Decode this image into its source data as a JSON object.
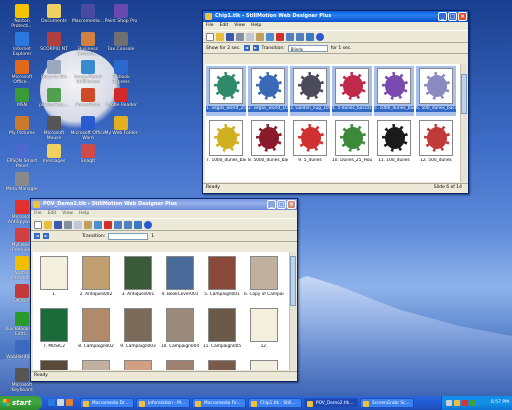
{
  "desktop_icons": [
    {
      "label": "Norton Protecti...",
      "color": "#f5c400"
    },
    {
      "label": "Internet Explorer",
      "color": "#2a79e0"
    },
    {
      "label": "Microsoft Office...",
      "color": "#e06a1a"
    },
    {
      "label": "MSN",
      "color": "#3a9a3a"
    },
    {
      "label": "My Pictures",
      "color": "#c97a2a"
    },
    {
      "label": "EPSON Smart Panel",
      "color": "#4a6ad0"
    },
    {
      "label": "Meta Manager",
      "color": "#8a8a8a"
    },
    {
      "label": "Microsoft AntiSpyware",
      "color": "#e03030"
    },
    {
      "label": "MyLabels Premium",
      "color": "#d04040"
    },
    {
      "label": "Norton Internet...",
      "color": "#f0c000"
    },
    {
      "label": "FAQGen",
      "color": "#c03a3a"
    },
    {
      "label": "QuickBooks Pro Editi...",
      "color": "#2a9a2a"
    },
    {
      "label": "WebPosition 3",
      "color": "#3a6ac0"
    },
    {
      "label": "Microsoft Keyboard",
      "color": "#555555"
    },
    {
      "label": "Documents",
      "color": "#f0d060"
    },
    {
      "label": "SCORPIO NT",
      "color": "#b04040"
    },
    {
      "label": "Recycle Bin",
      "color": "#9aa8c0"
    },
    {
      "label": "pPokerSetu...",
      "color": "#50a050"
    },
    {
      "label": "Microsoft Mouse",
      "color": "#555555"
    },
    {
      "label": "messages",
      "color": "#f0d060"
    },
    {
      "label": "Macromedia...",
      "color": "#4a4aa0"
    },
    {
      "label": "Business Contact...",
      "color": "#d08040"
    },
    {
      "label": "ImageMatch StillMotion",
      "color": "#3a8ad0"
    },
    {
      "label": "PowerPoint",
      "color": "#d04a2a"
    },
    {
      "label": "Microsoft Office Word",
      "color": "#2a5ad0"
    },
    {
      "label": "SnagIt",
      "color": "#d04a4a"
    },
    {
      "label": "Paint Shop Pro",
      "color": "#6a4ab0"
    },
    {
      "label": "Fax Console",
      "color": "#707070"
    },
    {
      "label": "Outlook Express",
      "color": "#2a6ad0"
    },
    {
      "label": "Adobe Reader",
      "color": "#d02a2a"
    },
    {
      "label": "My Web Folder",
      "color": "#e0b020"
    }
  ],
  "window_chips": {
    "title": "Chip1.tlk - StillMotion Web Designer Plus",
    "menu": [
      "File",
      "Edit",
      "View",
      "Help"
    ],
    "show_for_label": "Show for 2 sec.",
    "transition_label": "Transition:",
    "transition_value": "Blinds",
    "for_label": "for 1 sec.",
    "items": [
      {
        "caption": "1. vegas_world_2509",
        "selected": true,
        "color": "#2f8a6a"
      },
      {
        "caption": "2. vegas_world_1000",
        "selected": true,
        "color": "#3a6ab5"
      },
      {
        "caption": "3. Golden_nug_1000",
        "selected": true,
        "color": "#4a4a5a"
      },
      {
        "caption": "4. 5-dunes_baccarat",
        "selected": true,
        "color": "#c02a4a"
      },
      {
        "caption": "5. 1000_dunes_bacca",
        "selected": true,
        "color": "#7a4ab0"
      },
      {
        "caption": "6. 500_dunes_bacca",
        "selected": true,
        "color": "#8a8ac0"
      },
      {
        "caption": "7. 1000_dunes_bacca",
        "selected": false,
        "color": "#d0b020"
      },
      {
        "caption": "8. 5000_dunes_bacca",
        "selected": false,
        "color": "#8a1a2a"
      },
      {
        "caption": "9. 5_dunes",
        "selected": false,
        "color": "#d03030"
      },
      {
        "caption": "10. Dunes_25_House",
        "selected": false,
        "color": "#3a8a3a"
      },
      {
        "caption": "11. 100_dunes",
        "selected": false,
        "color": "#1a1a1a"
      },
      {
        "caption": "12. 500_dunes",
        "selected": false,
        "color": "#c03a3a"
      }
    ],
    "status_left": "Ready",
    "status_right": "Slide 6 of 14"
  },
  "window_pov": {
    "title": "POV_Demo2.tlk - StillMotion Web Designer Plus",
    "menu": [
      "File",
      "Edit",
      "View",
      "Help"
    ],
    "transition_label": "Transition:",
    "transition_value": "",
    "count_value": "1",
    "items": [
      {
        "caption": "1.",
        "color": "#f4f0e0"
      },
      {
        "caption": "2. Antiques002",
        "color": "#c0a070"
      },
      {
        "caption": "3. Antiques001",
        "color": "#3a5a3a"
      },
      {
        "caption": "4. BookCover001",
        "color": "#4a6a9a"
      },
      {
        "caption": "5. Campaign001",
        "color": "#8a4a3a"
      },
      {
        "caption": "6. Copy of Campaign002",
        "color": "#c0b0a0"
      },
      {
        "caption": "7. MUSIC2",
        "color": "#1a6a3a"
      },
      {
        "caption": "8. Campaign002",
        "color": "#b08a6a"
      },
      {
        "caption": "9. Campaign003",
        "color": "#7a6a5a"
      },
      {
        "caption": "10. Campaign004",
        "color": "#9a8a7a"
      },
      {
        "caption": "11. Campaign005",
        "color": "#6a5a4a"
      },
      {
        "caption": "12.",
        "color": "#f4f0e0"
      },
      {
        "caption": "",
        "color": "#5a4a3a"
      },
      {
        "caption": "",
        "color": "#c0b0a0"
      },
      {
        "caption": "",
        "color": "#d0a080"
      },
      {
        "caption": "",
        "color": "#a08070"
      },
      {
        "caption": "",
        "color": "#7a5a4a"
      },
      {
        "caption": "",
        "color": "#f4f0e0"
      }
    ],
    "status_left": "Ready"
  },
  "taskbar": {
    "start_label": "start",
    "tasks": [
      {
        "label": "Macromedia Dr...",
        "active": false
      },
      {
        "label": "Information - M...",
        "active": false
      },
      {
        "label": "Macromedia Fir...",
        "active": false
      },
      {
        "label": "Chip1.tlk - Still...",
        "active": false
      },
      {
        "label": "POV_Demo2.tlk...",
        "active": true
      },
      {
        "label": "ScreenGrabr Sc...",
        "active": false
      }
    ],
    "clock": "6:57 PM"
  }
}
